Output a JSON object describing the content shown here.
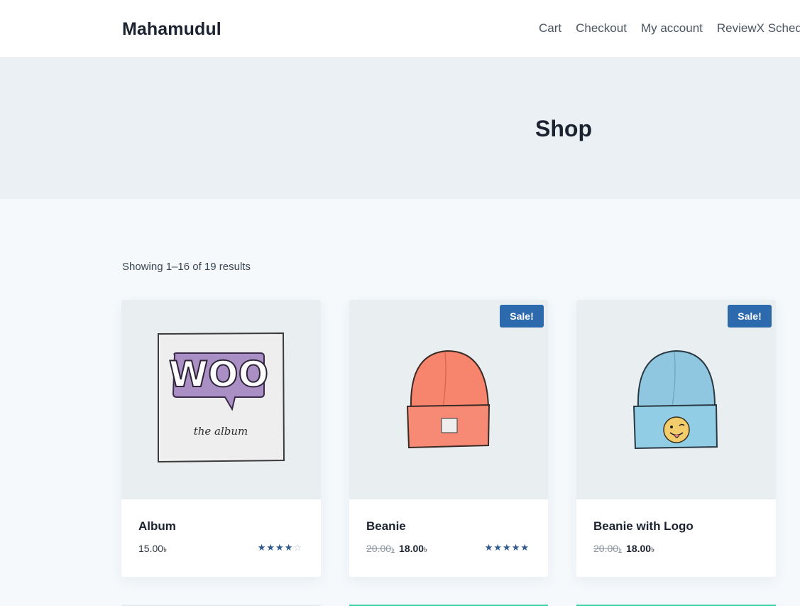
{
  "header": {
    "site_title": "Mahamudul",
    "nav": [
      "Cart",
      "Checkout",
      "My account",
      "ReviewX Schedu"
    ]
  },
  "hero": {
    "title": "Shop"
  },
  "shop": {
    "result_count": "Showing 1–16 of 19 results",
    "products": [
      {
        "name": "Album",
        "price": "15.00",
        "currency": "৳",
        "rating": 4,
        "on_sale": false,
        "image": "woo-album-cover"
      },
      {
        "name": "Beanie",
        "old_price": "20.00",
        "price": "18.00",
        "currency": "৳",
        "rating": 5,
        "on_sale": true,
        "sale_label": "Sale!",
        "image": "orange-beanie"
      },
      {
        "name": "Beanie with Logo",
        "old_price": "20.00",
        "price": "18.00",
        "currency": "৳",
        "on_sale": true,
        "sale_label": "Sale!",
        "image": "blue-beanie-with-logo"
      }
    ]
  },
  "album_art": {
    "logo_text": "WOO",
    "caption": "the album"
  },
  "colors": {
    "accent": "#2c69ad",
    "star": "#2c5a91",
    "hero_bg": "#ebf0f4",
    "page_bg": "#f5f9fc"
  }
}
